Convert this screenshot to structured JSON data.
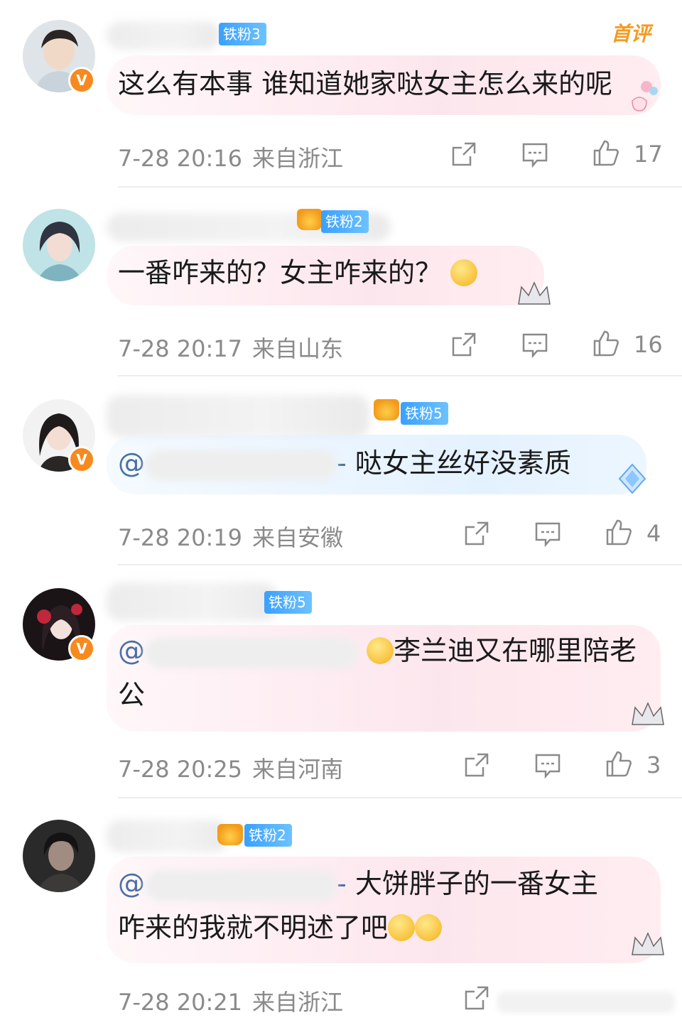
{
  "first_comment_label": "首评",
  "comments": [
    {
      "fan_label": "铁粉3",
      "text": "这么有本事 谁知道她家哒女主怎么来的呢",
      "time": "7-28 20:16",
      "location": "来自浙江",
      "likes": "17",
      "verified": "V"
    },
    {
      "fan_label": "铁粉2",
      "text": "一番咋来的？女主咋来的？",
      "time": "7-28 20:17",
      "location": "来自山东",
      "likes": "16"
    },
    {
      "fan_label": "铁粉5",
      "mention_prefix": "@",
      "mention_suffix": "-",
      "text": "哒女主丝好没素质",
      "time": "7-28 20:19",
      "location": "来自安徽",
      "likes": "4",
      "verified": "V"
    },
    {
      "fan_label": "铁粉5",
      "mention_prefix": "@",
      "text_line1": "李兰迪又在哪里陪老",
      "text_line2": "公",
      "time": "7-28 20:25",
      "location": "来自河南",
      "likes": "3",
      "verified": "V"
    },
    {
      "fan_label": "铁粉2",
      "mention_prefix": "@",
      "mention_suffix": "-",
      "text_line1": "大饼胖子的一番女主",
      "text_line2": "咋来的我就不明述了吧",
      "time": "7-28 20:21",
      "location": "来自浙江"
    }
  ],
  "colors": {
    "meta_gray": "#8a8a8a",
    "fan_badge_blue": "#3aa0ff",
    "verified_orange": "#f78a1e",
    "first_comment_orange": "#f59a1f",
    "mention_blue": "#4a6fa5"
  }
}
